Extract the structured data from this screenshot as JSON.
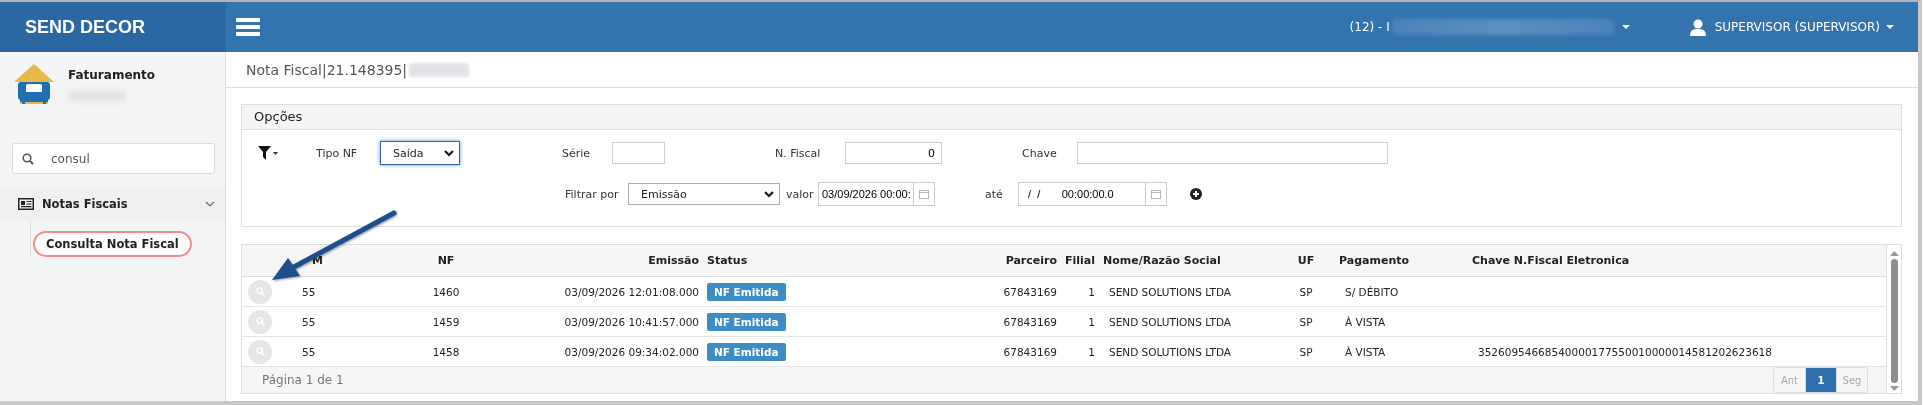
{
  "brand": "SEND DECOR",
  "header": {
    "company": "(12) - I",
    "user": "SUPERVISOR (SUPERVISOR)"
  },
  "sidebar": {
    "module": "Faturamento",
    "search": {
      "value": "consul"
    },
    "menu": [
      {
        "label": "Notas Fiscais",
        "expanded": true,
        "children": [
          {
            "label": "Consulta Nota Fiscal",
            "selected": true
          }
        ]
      }
    ]
  },
  "breadcrumb": "Nota Fiscal|21.148395|",
  "options": {
    "title": "Opções",
    "first_line": [
      {
        "label": "Tipo NF",
        "kind": "select",
        "value": "Saída",
        "focused": true
      },
      {
        "label": "Série",
        "kind": "text",
        "focused": false
      },
      {
        "label": "N. Fiscal",
        "kind": "number",
        "value": "0",
        "focused": false
      },
      {
        "label": "Chave",
        "kind": "text",
        "focused": false
      }
    ],
    "second_line": [
      {
        "label": "Filtrar por",
        "kind": "select",
        "value": "Emissão",
        "focused": false
      },
      {
        "label": "valor",
        "kind": "date",
        "value": "03/09/2026 00:00:",
        "focused": false
      },
      {
        "label": "até",
        "kind": "date",
        "value": "  /  /       00:00:00.0",
        "focused": false
      }
    ]
  },
  "table": {
    "columns": [
      "M",
      "NF",
      "Emissão",
      "Status",
      "Parceiro",
      "Filial",
      "Nome/Razão Social",
      "UF",
      "Pagamento",
      "Chave N.Fiscal Eletronica"
    ],
    "rows": [
      {
        "cells": [
          "55",
          "1460",
          "03/09/2026 12:01:08.000",
          "NF Emitida",
          "67843169",
          "1",
          "SEND SOLUTIONS LTDA",
          "SP",
          "S/ DÉBITO",
          ""
        ]
      },
      {
        "cells": [
          "55",
          "1459",
          "03/09/2026 10:41:57.000",
          "NF Emitida",
          "67843169",
          "1",
          "SEND SOLUTIONS LTDA",
          "SP",
          "À VISTA",
          ""
        ]
      },
      {
        "cells": [
          "55",
          "1458",
          "03/09/2026 09:34:02.000",
          "NF Emitida",
          "67843169",
          "1",
          "SEND SOLUTIONS LTDA",
          "SP",
          "À VISTA",
          "35260954668540000177550010000014581202623618"
        ]
      }
    ],
    "footer": "Página 1 de 1",
    "pagination": [
      {
        "label": "Ant",
        "selected": false,
        "disabled": true
      },
      {
        "label": "1",
        "selected": true,
        "disabled": false
      },
      {
        "label": "Seg",
        "selected": false,
        "disabled": true
      }
    ]
  }
}
